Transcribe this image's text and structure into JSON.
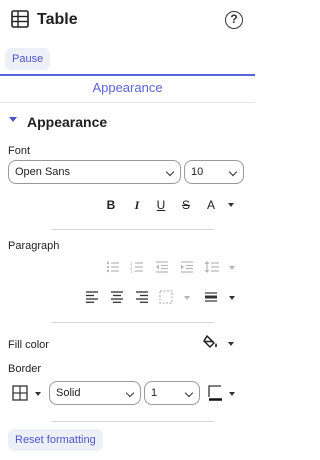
{
  "header": {
    "title": "Table",
    "help_label": "?"
  },
  "controls": {
    "pause_label": "Pause"
  },
  "tabs": {
    "active": "Appearance"
  },
  "section": {
    "title": "Appearance"
  },
  "font": {
    "label": "Font",
    "family": "Open Sans",
    "size": "10",
    "format_buttons": {
      "bold": "B",
      "italic": "I",
      "underline": "U",
      "strike": "S",
      "text_color": "A"
    }
  },
  "paragraph": {
    "label": "Paragraph"
  },
  "fill": {
    "label": "Fill color"
  },
  "border": {
    "label": "Border",
    "style": "Solid",
    "width": "1"
  },
  "footer": {
    "reset_label": "Reset formatting"
  },
  "colors": {
    "accent": "#5a63d8",
    "pill_bg": "#eef0f9",
    "disabled": "#b6b6b6"
  }
}
